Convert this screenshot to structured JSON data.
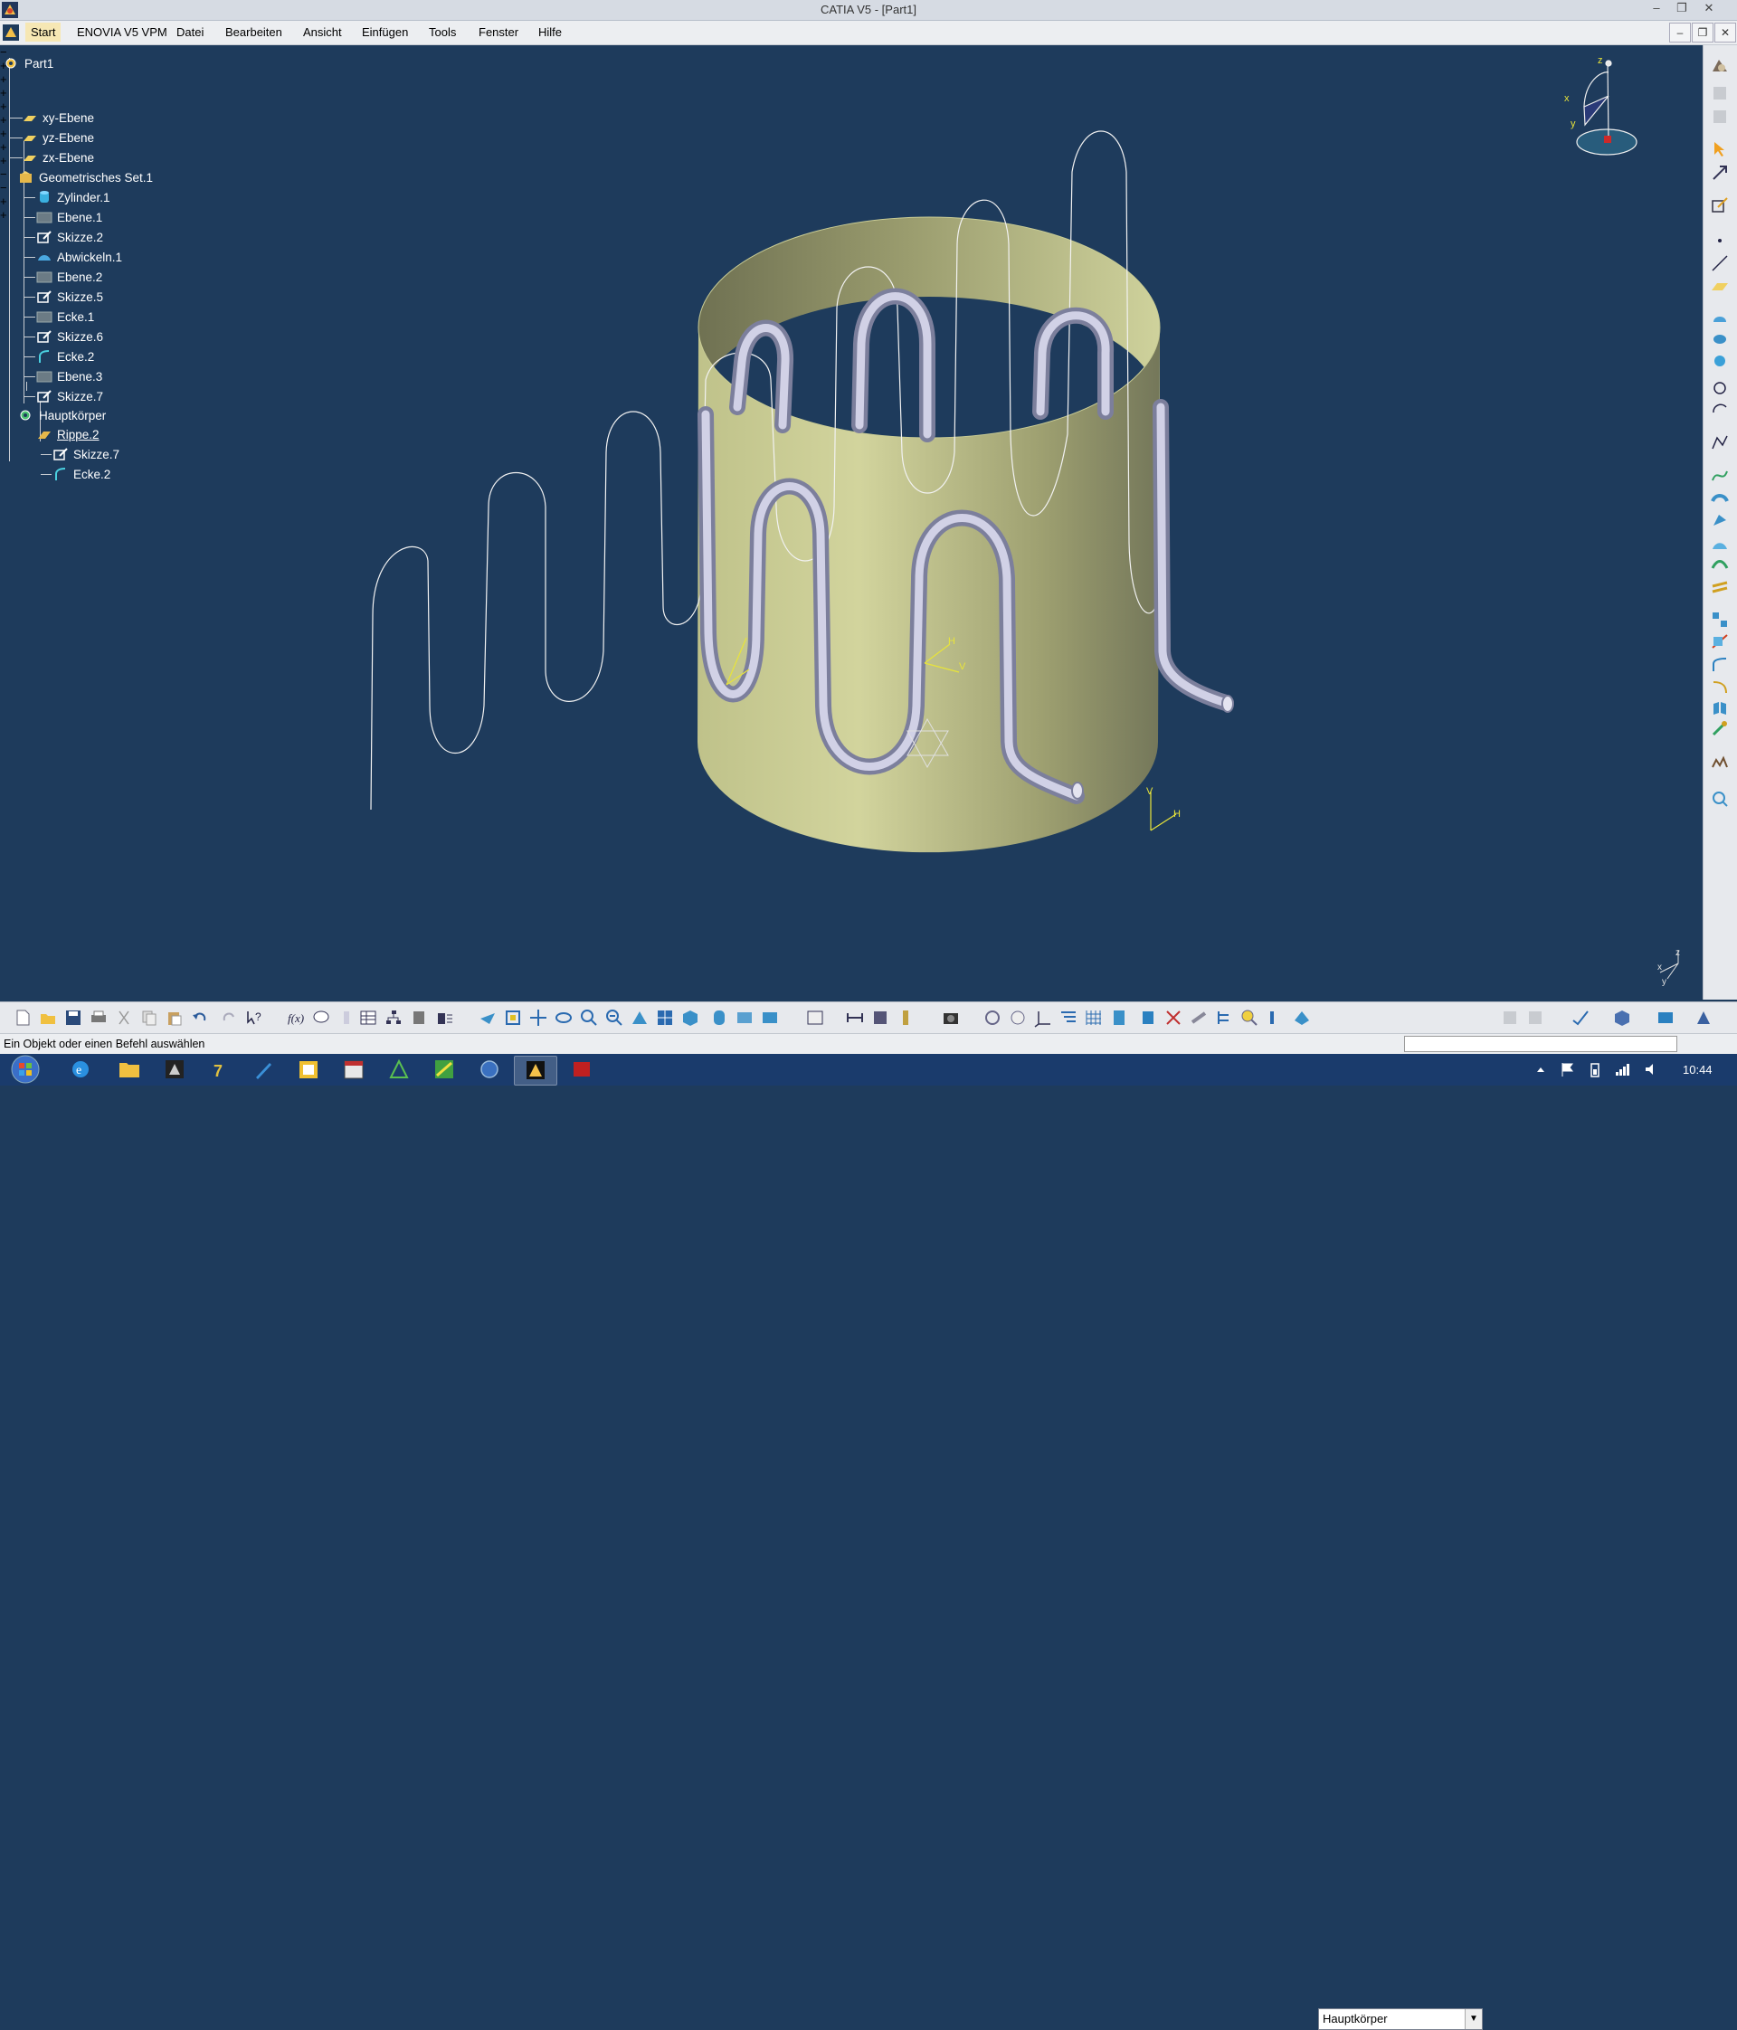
{
  "window": {
    "title": "CATIA V5 - [Part1]",
    "minimize": "–",
    "restore": "❐",
    "close": "✕"
  },
  "menu": {
    "items": [
      "Start",
      "ENOVIA V5 VPM",
      "Datei",
      "Bearbeiten",
      "Ansicht",
      "Einfügen",
      "Tools",
      "Fenster",
      "Hilfe"
    ],
    "doc_minimize": "–",
    "doc_restore": "❐",
    "doc_close": "✕"
  },
  "tree": {
    "root": "Part1",
    "planes": [
      "xy-Ebene",
      "yz-Ebene",
      "zx-Ebene"
    ],
    "geoset": {
      "label": "Geometrisches Set.1",
      "children": [
        "Zylinder.1",
        "Ebene.1",
        "Skizze.2",
        "Abwickeln.1",
        "Ebene.2",
        "Skizze.5",
        "Ecke.1",
        "Skizze.6",
        "Ecke.2",
        "Ebene.3",
        "Skizze.7"
      ]
    },
    "body": {
      "label": "Hauptkörper",
      "feature": "Rippe.2",
      "feature_children": [
        "Skizze.7",
        "Ecke.2"
      ]
    }
  },
  "compass": {
    "x": "x",
    "y": "y",
    "z": "z"
  },
  "axis_labels": {
    "h": "H",
    "v": "V"
  },
  "mini_axes": {
    "x": "x",
    "y": "y",
    "z": "z"
  },
  "toolbar": {
    "current_body": "Hauptkörper"
  },
  "status": {
    "message": "Ein Objekt oder einen Befehl auswählen"
  },
  "taskbar": {
    "clock": "10:44"
  },
  "colors": {
    "background": "#1e3b5c",
    "cylinder_light": "#cfd19a",
    "cylinder_dark": "#7c7e5a",
    "tube": "#c4c4dc"
  }
}
